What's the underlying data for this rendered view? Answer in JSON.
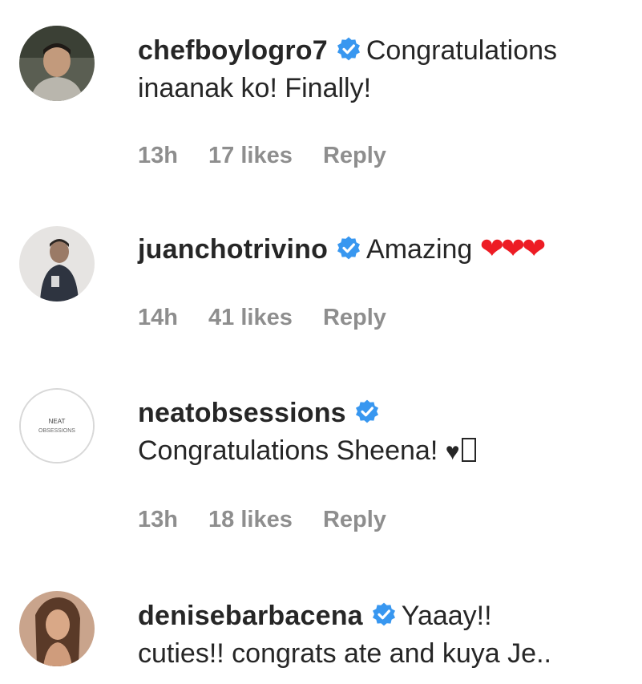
{
  "comments": [
    {
      "username": "chefboylogro7",
      "text_line1": "Congratulations",
      "text_line2": "inaanak ko! Finally!",
      "time": "13h",
      "likes": "17 likes",
      "reply": "Reply"
    },
    {
      "username": "juanchotrivino",
      "text_line1": "Amazing",
      "hearts": "❤❤❤",
      "time": "14h",
      "likes": "41 likes",
      "reply": "Reply"
    },
    {
      "username": "neatobsessions",
      "text_line2": "Congratulations Sheena!",
      "heart": "♥",
      "avatar_text": "NEAT OBSESSIONS",
      "time": "13h",
      "likes": "18 likes",
      "reply": "Reply"
    },
    {
      "username": "denisebarbacena",
      "text_line1": "Yaaay!!",
      "text_line2": "cuties!! congrats ate and kuya Je..",
      "time": "",
      "likes": "",
      "reply": ""
    }
  ],
  "colors": {
    "verified": "#3897f0",
    "meta": "#8e8e8e",
    "heart_red": "#ed1c24"
  },
  "icons": {
    "verified": "verified-badge-icon"
  }
}
